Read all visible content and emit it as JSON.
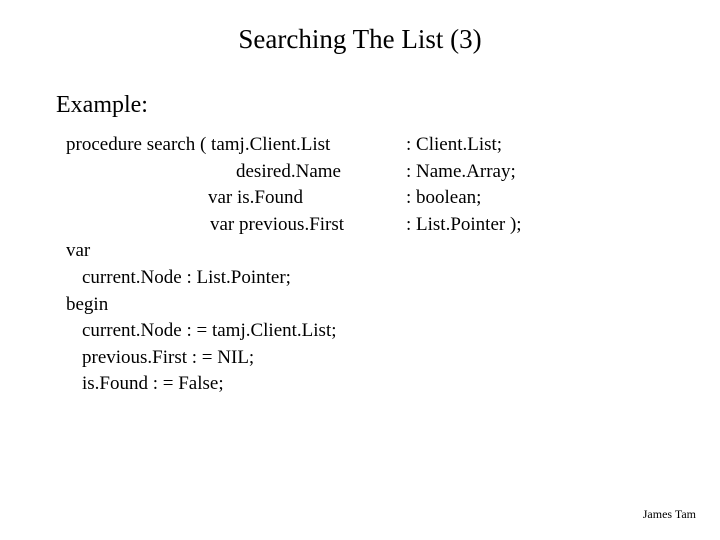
{
  "title": "Searching The List (3)",
  "example_label": "Example:",
  "sig": {
    "line1_left": "procedure search (    tamj.Client.List",
    "line1_right": ": Client.List;",
    "line2_left": "desired.Name",
    "line2_right": ": Name.Array;",
    "line3_left": "var is.Found",
    "line3_right": ": boolean;",
    "line4_left": "var previous.First",
    "line4_right": ": List.Pointer );"
  },
  "body_lines": {
    "l1": "var",
    "l2": "current.Node : List.Pointer;",
    "l3": "begin",
    "l4": "current.Node : = tamj.Client.List;",
    "l5": "previous.First : = NIL;",
    "l6": "is.Found : = False;"
  },
  "footer": "James Tam"
}
